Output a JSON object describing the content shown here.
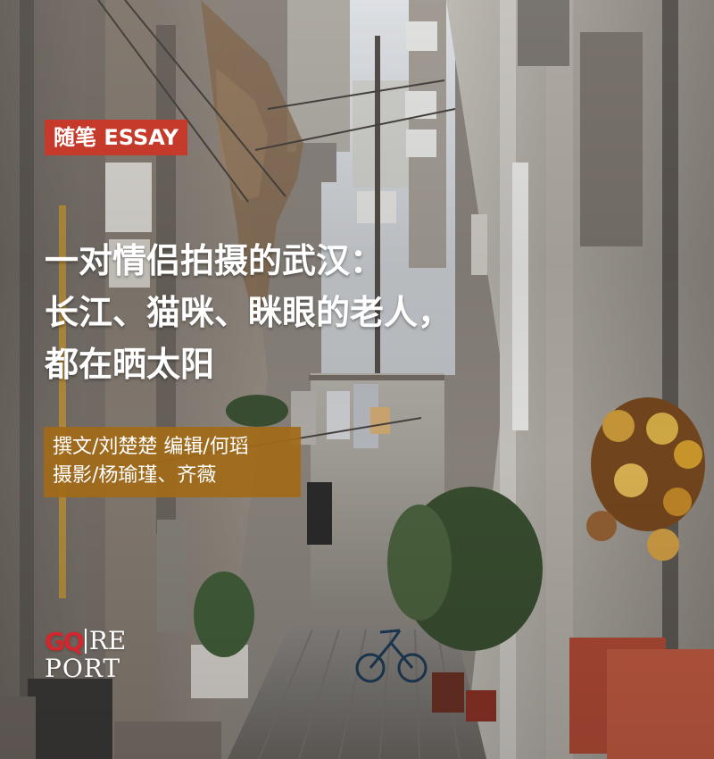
{
  "badge": {
    "label": "随笔 ESSAY"
  },
  "headline": {
    "lines": [
      "一对情侣拍摄的武汉：",
      "长江、猫咪、眯眼的老人，",
      "都在晒太阳"
    ]
  },
  "credits": {
    "line1": "撰文/刘楚楚  编辑/何瑫",
    "line2": "摄影/杨瑜瑾、齐薇"
  },
  "logo": {
    "mark": "GQ",
    "re": "RE",
    "port": "PORT"
  },
  "colors": {
    "badge_bg": "#c53a2a",
    "credits_bg": "#a26a18",
    "logo_red": "#d4262c"
  }
}
